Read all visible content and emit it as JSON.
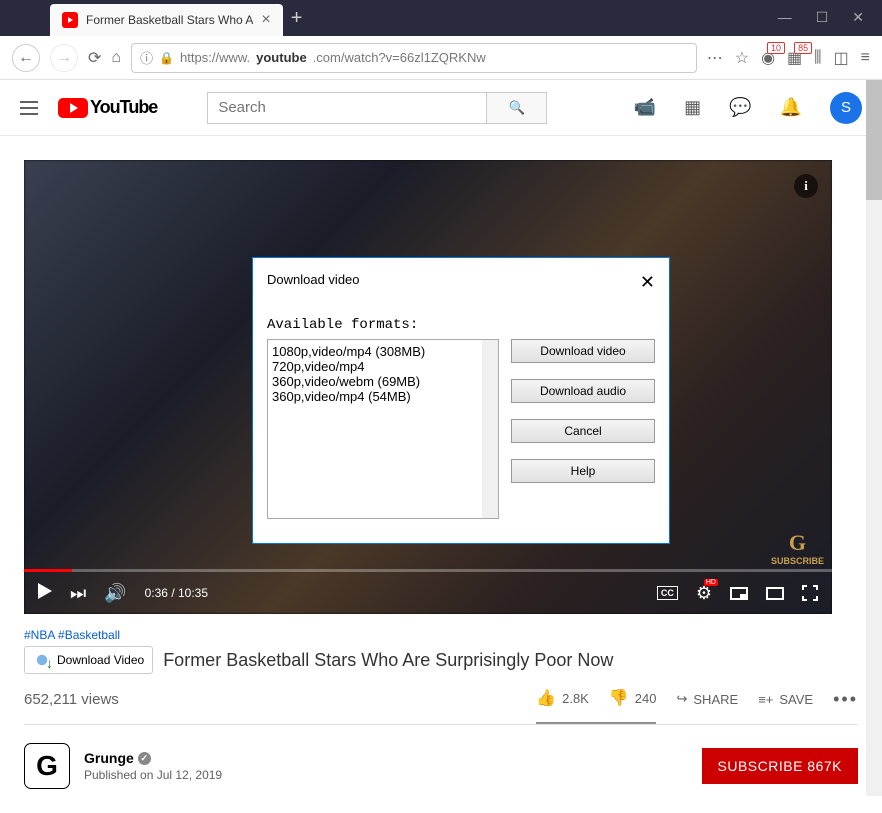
{
  "browser": {
    "tab_title": "Former Basketball Stars Who A",
    "url_prefix": "https://www.",
    "url_domain": "youtube",
    "url_suffix": ".com/watch?v=66zl1ZQRKNw",
    "badge1": "10",
    "badge2": "85"
  },
  "yt": {
    "logo_text": "YouTube",
    "search_placeholder": "Search",
    "avatar_letter": "S"
  },
  "player": {
    "current_time": "0:36",
    "duration": "10:35",
    "subscribe_watermark": "SUBSCRIBE"
  },
  "dialog": {
    "title": "Download video",
    "formats_label": "Available formats:",
    "formats": [
      "1080p,video/mp4 (308MB)",
      "720p,video/mp4",
      "360p,video/webm (69MB)",
      "360p,video/mp4 (54MB)"
    ],
    "btn_download_video": "Download video",
    "btn_download_audio": "Download audio",
    "btn_cancel": "Cancel",
    "btn_help": "Help"
  },
  "video": {
    "hashtags": "#NBA #Basketball",
    "download_btn": "Download Video",
    "title": "Former Basketball Stars Who Are Surprisingly Poor Now",
    "views": "652,211 views",
    "likes": "2.8K",
    "dislikes": "240",
    "share": "SHARE",
    "save": "SAVE"
  },
  "channel": {
    "avatar_letter": "G",
    "name": "Grunge",
    "published": "Published on Jul 12, 2019",
    "subscribe": "SUBSCRIBE  867K"
  }
}
